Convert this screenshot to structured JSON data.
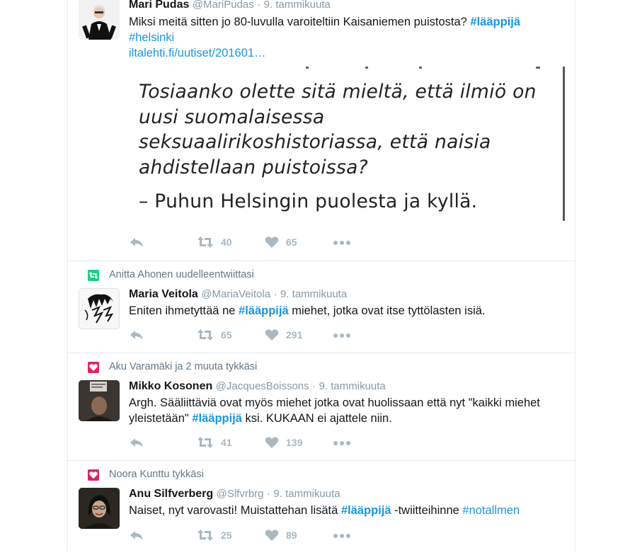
{
  "colors": {
    "link": "#1b95e0",
    "muted": "#657786",
    "icon": "#aab8c2",
    "like_context": "#e0245e",
    "retweet_context": "#19cf86"
  },
  "tweets": [
    {
      "fullname": "Mari Pudas",
      "handle": "@MariPudas",
      "time": "9. tammikuuta",
      "text_before": "Miksi meitä sitten jo 80-luvulla varoiteltiin Kaisaniemen puistosta? ",
      "hashtag1": "#lääppijä",
      "hashtag2": "#helsinki",
      "link": "iltalehti.fi/uutiset/201601…",
      "media": {
        "quote": "Tosiaanko olette sitä mieltä, että ilmiö on uusi suomalaisessa seksuaalirikoshistoriassa, että naisia ahdistellaan puistoissa?",
        "answer": "– Puhun Helsingin puolesta ja kyllä."
      },
      "retweets": "40",
      "likes": "65"
    },
    {
      "context": "Anitta Ahonen uudelleentwiittasi",
      "context_icon": "retweet-icon",
      "fullname": "Maria Veitola",
      "handle": "@MariaVeitola",
      "time": "9. tammikuuta",
      "text_before": "Eniten ihmetyttää ne ",
      "hashtag": "#lääppijä",
      "text_after": " miehet, jotka ovat itse tyttölasten isiä.",
      "retweets": "65",
      "likes": "291"
    },
    {
      "context": "Aku Varamäki ja 2 muuta tykkäsi",
      "context_icon": "heart-icon",
      "fullname": "Mikko Kosonen",
      "handle": "@JacquesBoissons",
      "time": "9. tammikuuta",
      "text_line1": "Argh. Sääliittäviä ovat myös miehet jotka ovat huolissaan että nyt \"kaikki miehet",
      "text_before": "yleistetään\" ",
      "hashtag": "#lääppijä",
      "text_after": " ksi. KUKAAN ei ajattele niin.",
      "retweets": "41",
      "likes": "139"
    },
    {
      "context": "Noora Kunttu tykkäsi",
      "context_icon": "heart-icon",
      "fullname": "Anu Silfverberg",
      "handle": "@Slfvrbrg",
      "time": "9. tammikuuta",
      "text_before": "Naiset, nyt varovasti! Muistattehan lisätä ",
      "hashtag": "#lääppijä",
      "text_middle": " -twiitteihinne ",
      "hashtag2": "#notallmen",
      "retweets": "25",
      "likes": "89"
    }
  ]
}
